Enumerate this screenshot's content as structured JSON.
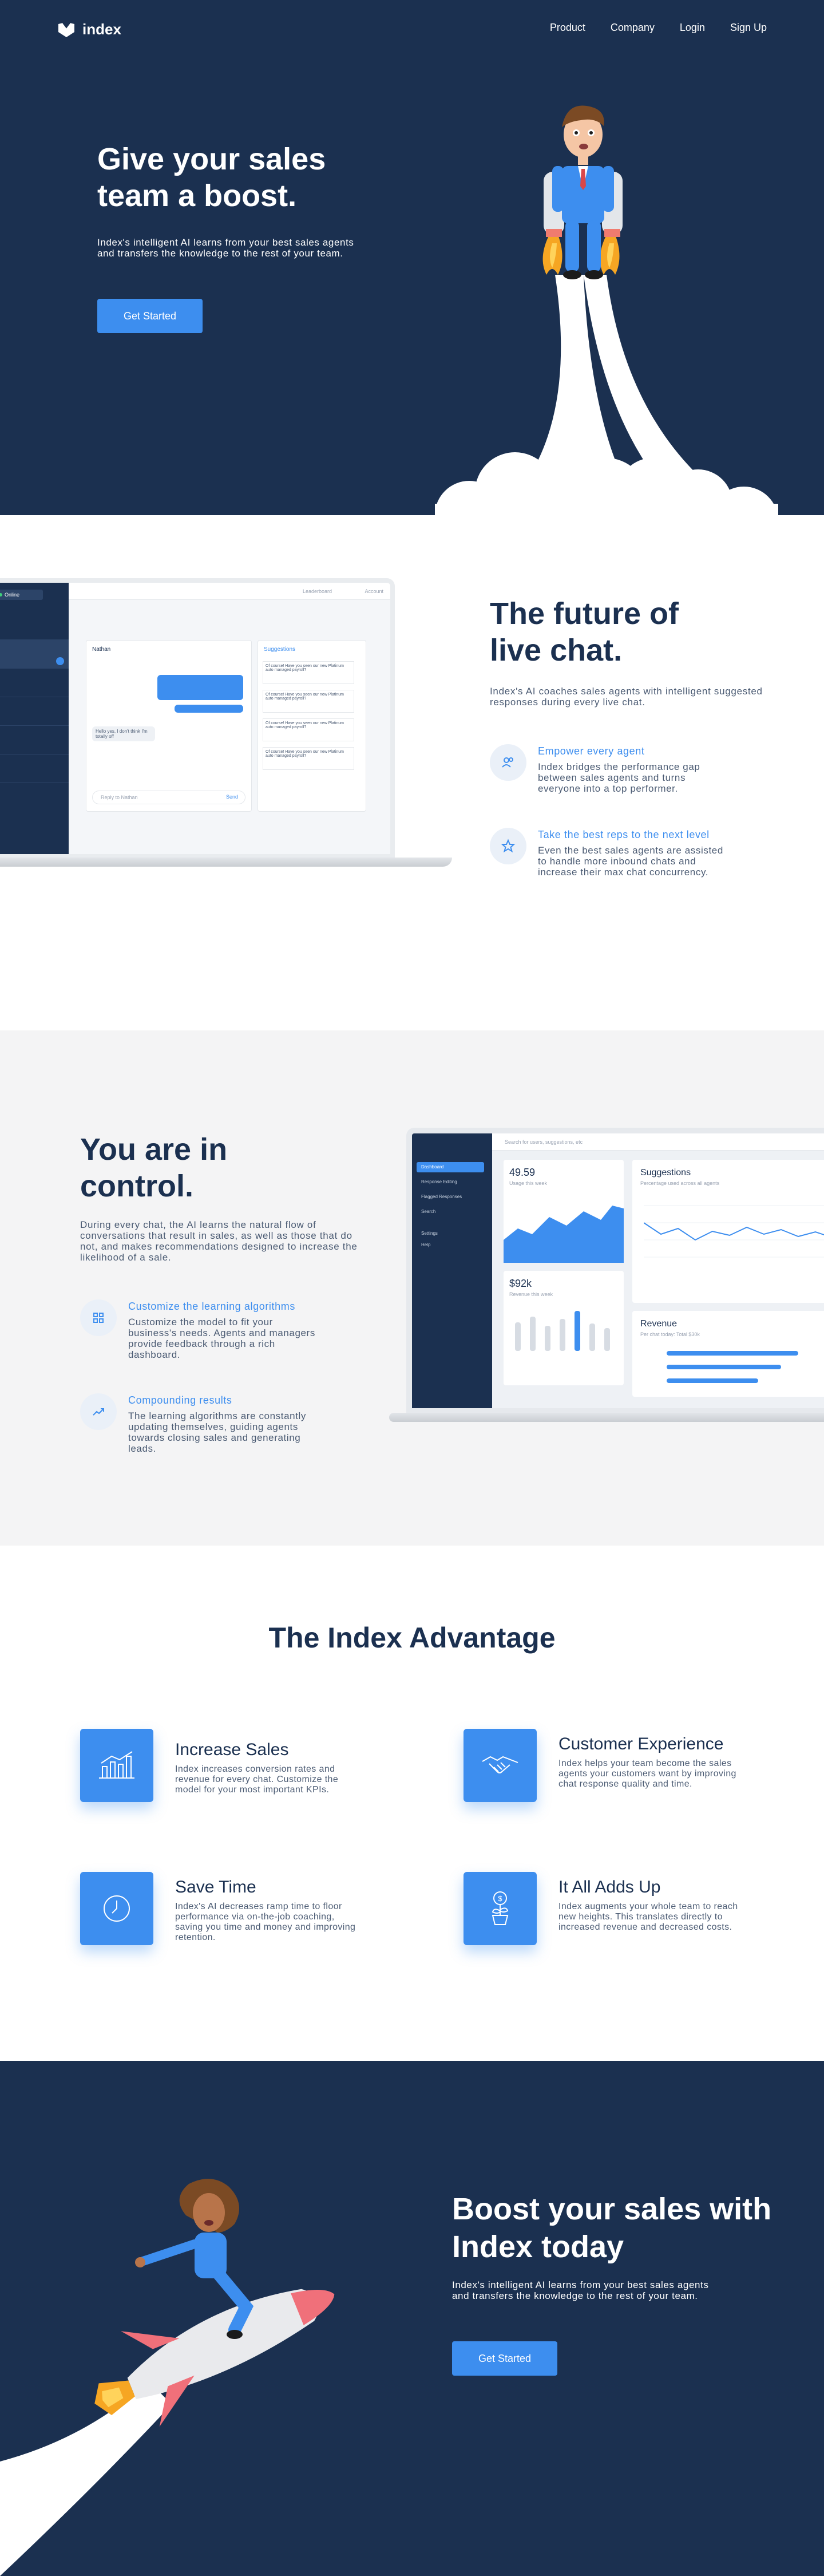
{
  "brand": {
    "name": "index"
  },
  "nav": {
    "items": [
      "Product",
      "Company",
      "Login",
      "Sign Up"
    ]
  },
  "hero": {
    "title": "Give your sales team a boost.",
    "subtitle": "Index's intelligent AI learns from your best sales agents and transfers the knowledge to the rest of your team.",
    "button": "Get Started"
  },
  "future": {
    "title": "The future of live chat.",
    "subtitle": "Index's AI coaches sales agents with intelligent suggested responses during every live chat.",
    "features": [
      {
        "title": "Empower every agent",
        "text": "Index bridges the performance gap between sales agents and turns everyone into a top performer.",
        "icon": "users-icon"
      },
      {
        "title": "Take the best reps to the next level",
        "text": "Even the best sales agents are assisted to handle more inbound chats and increase their max chat concurrency.",
        "icon": "star-icon"
      }
    ],
    "mock": {
      "status": "Online",
      "panel_title": "Suggestions",
      "chat_name": "Nathan",
      "user_msg": "Hello yes, I don't think I'm totally off",
      "input_placeholder": "Reply to Nathan",
      "send": "Send",
      "crumb": "Leaderboard",
      "account": "Account",
      "suggestion_text": "Of course! Have you seen our new Platinum auto managed payroll?"
    }
  },
  "control": {
    "title": "You are in control.",
    "subtitle": "During every chat, the AI learns the natural flow of conversations that result in sales, as well as those that do not, and makes recommendations designed to increase the likelihood of a sale.",
    "features": [
      {
        "title": "Customize the learning algorithms",
        "text": "Customize the model to fit your business's needs. Agents and managers provide feedback through a rich dashboard.",
        "icon": "grid-icon"
      },
      {
        "title": "Compounding results",
        "text": "The learning algorithms are constantly updating themselves, guiding agents towards closing sales and generating leads.",
        "icon": "trend-icon"
      }
    ],
    "dashboard": {
      "search_placeholder": "Search for users, suggestions, etc",
      "menu": [
        "Dashboard",
        "Response Editing",
        "Flagged Responses",
        "Search",
        "Settings",
        "Help"
      ],
      "usage_value": "49.59",
      "usage_label": "Usage this week",
      "revenue_value": "$92k",
      "revenue_label": "Revenue this week",
      "suggestions_title": "Suggestions",
      "suggestions_sub": "Percentage used across all agents",
      "revenue_title": "Revenue",
      "revenue_sub": "Per chat today: Total $30k"
    }
  },
  "advantage": {
    "title": "The Index Advantage",
    "items": [
      {
        "title": "Increase Sales",
        "text": "Index increases conversion rates and revenue for every chat. Customize the model for your most important KPIs.",
        "icon": "bar-chart-icon"
      },
      {
        "title": "Customer Experience",
        "text": "Index helps your team become the sales agents your customers want by improving chat response quality and time.",
        "icon": "handshake-icon"
      },
      {
        "title": "Save Time",
        "text": "Index's AI decreases ramp time to floor performance via on-the-job coaching, saving you time and money and improving retention.",
        "icon": "clock-icon"
      },
      {
        "title": "It All Adds Up",
        "text": "Index augments your whole team to reach new heights. This translates directly to increased revenue and decreased costs.",
        "icon": "money-plant-icon"
      }
    ]
  },
  "cta": {
    "title": "Boost your sales with Index today",
    "subtitle": "Index's intelligent AI learns from your best sales agents and transfers the knowledge to the rest of your team.",
    "button": "Get Started"
  },
  "colors": {
    "navy": "#1b3050",
    "accent": "#3d8eef",
    "light": "#f4f4f5"
  }
}
